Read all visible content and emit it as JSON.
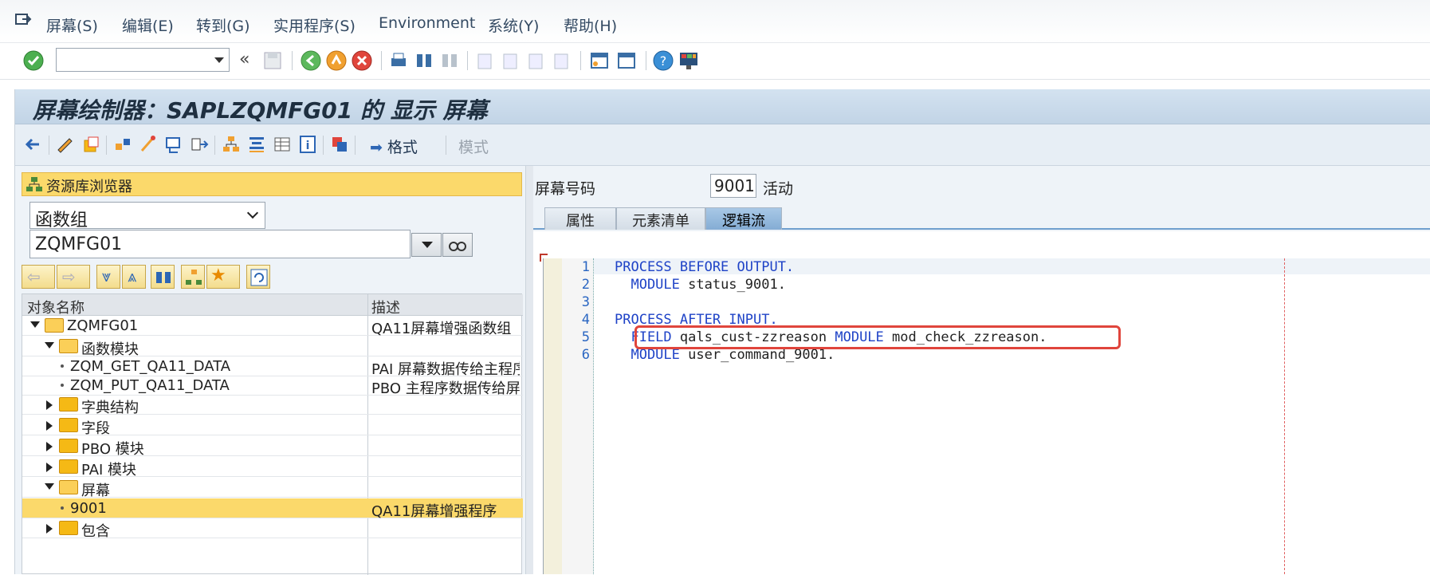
{
  "menu": {
    "items": [
      {
        "label": "屏幕(S)"
      },
      {
        "label": "编辑(E)"
      },
      {
        "label": "转到(G)"
      },
      {
        "label": "实用程序(S)"
      },
      {
        "label": "Environment"
      },
      {
        "label": "系统(Y)"
      },
      {
        "label": "帮助(H)"
      }
    ]
  },
  "toolbar": {
    "command_value": ""
  },
  "title": "屏幕绘制器：SAPLZQMFG01 的 显示 屏幕",
  "app_toolbar": {
    "format_label": "格式",
    "mode_label": "模式"
  },
  "repo": {
    "header": "资源库浏览器",
    "type_value": "函数组",
    "object_value": "ZQMFG01",
    "col_name": "对象名称",
    "col_desc": "描述",
    "rows": [
      {
        "name": "ZQMFG01",
        "desc": "QA11屏幕增强函数组"
      },
      {
        "name": "函数模块",
        "desc": ""
      },
      {
        "name": "ZQM_GET_QA11_DATA",
        "desc": "PAI 屏幕数据传给主程序"
      },
      {
        "name": "ZQM_PUT_QA11_DATA",
        "desc": "PBO 主程序数据传给屏幕"
      },
      {
        "name": "字典结构",
        "desc": ""
      },
      {
        "name": "字段",
        "desc": ""
      },
      {
        "name": "PBO 模块",
        "desc": ""
      },
      {
        "name": "PAI 模块",
        "desc": ""
      },
      {
        "name": "屏幕",
        "desc": ""
      },
      {
        "name": "9001",
        "desc": "QA11屏幕增强程序"
      },
      {
        "name": "包含",
        "desc": ""
      }
    ]
  },
  "screen": {
    "label": "屏幕号码",
    "number": "9001",
    "status": "活动",
    "tabs": [
      "属性",
      "元素清单",
      "逻辑流"
    ]
  },
  "code": {
    "line_numbers": [
      "1",
      "2",
      "3",
      "4",
      "5",
      "6"
    ],
    "lines": [
      {
        "kw": "PROCESS BEFORE OUTPUT.",
        "rest": ""
      },
      {
        "kw": "  MODULE",
        "rest": " status_9001."
      },
      {
        "kw": "",
        "rest": ""
      },
      {
        "kw": "PROCESS AFTER INPUT.",
        "rest": ""
      },
      {
        "kw": "  FIELD",
        "rest": " qals_cust-zzreason ",
        "kw2": "MODULE",
        "rest2": " mod_check_zzreason."
      },
      {
        "kw": "  MODULE",
        "rest": " user_command_9001."
      }
    ]
  }
}
